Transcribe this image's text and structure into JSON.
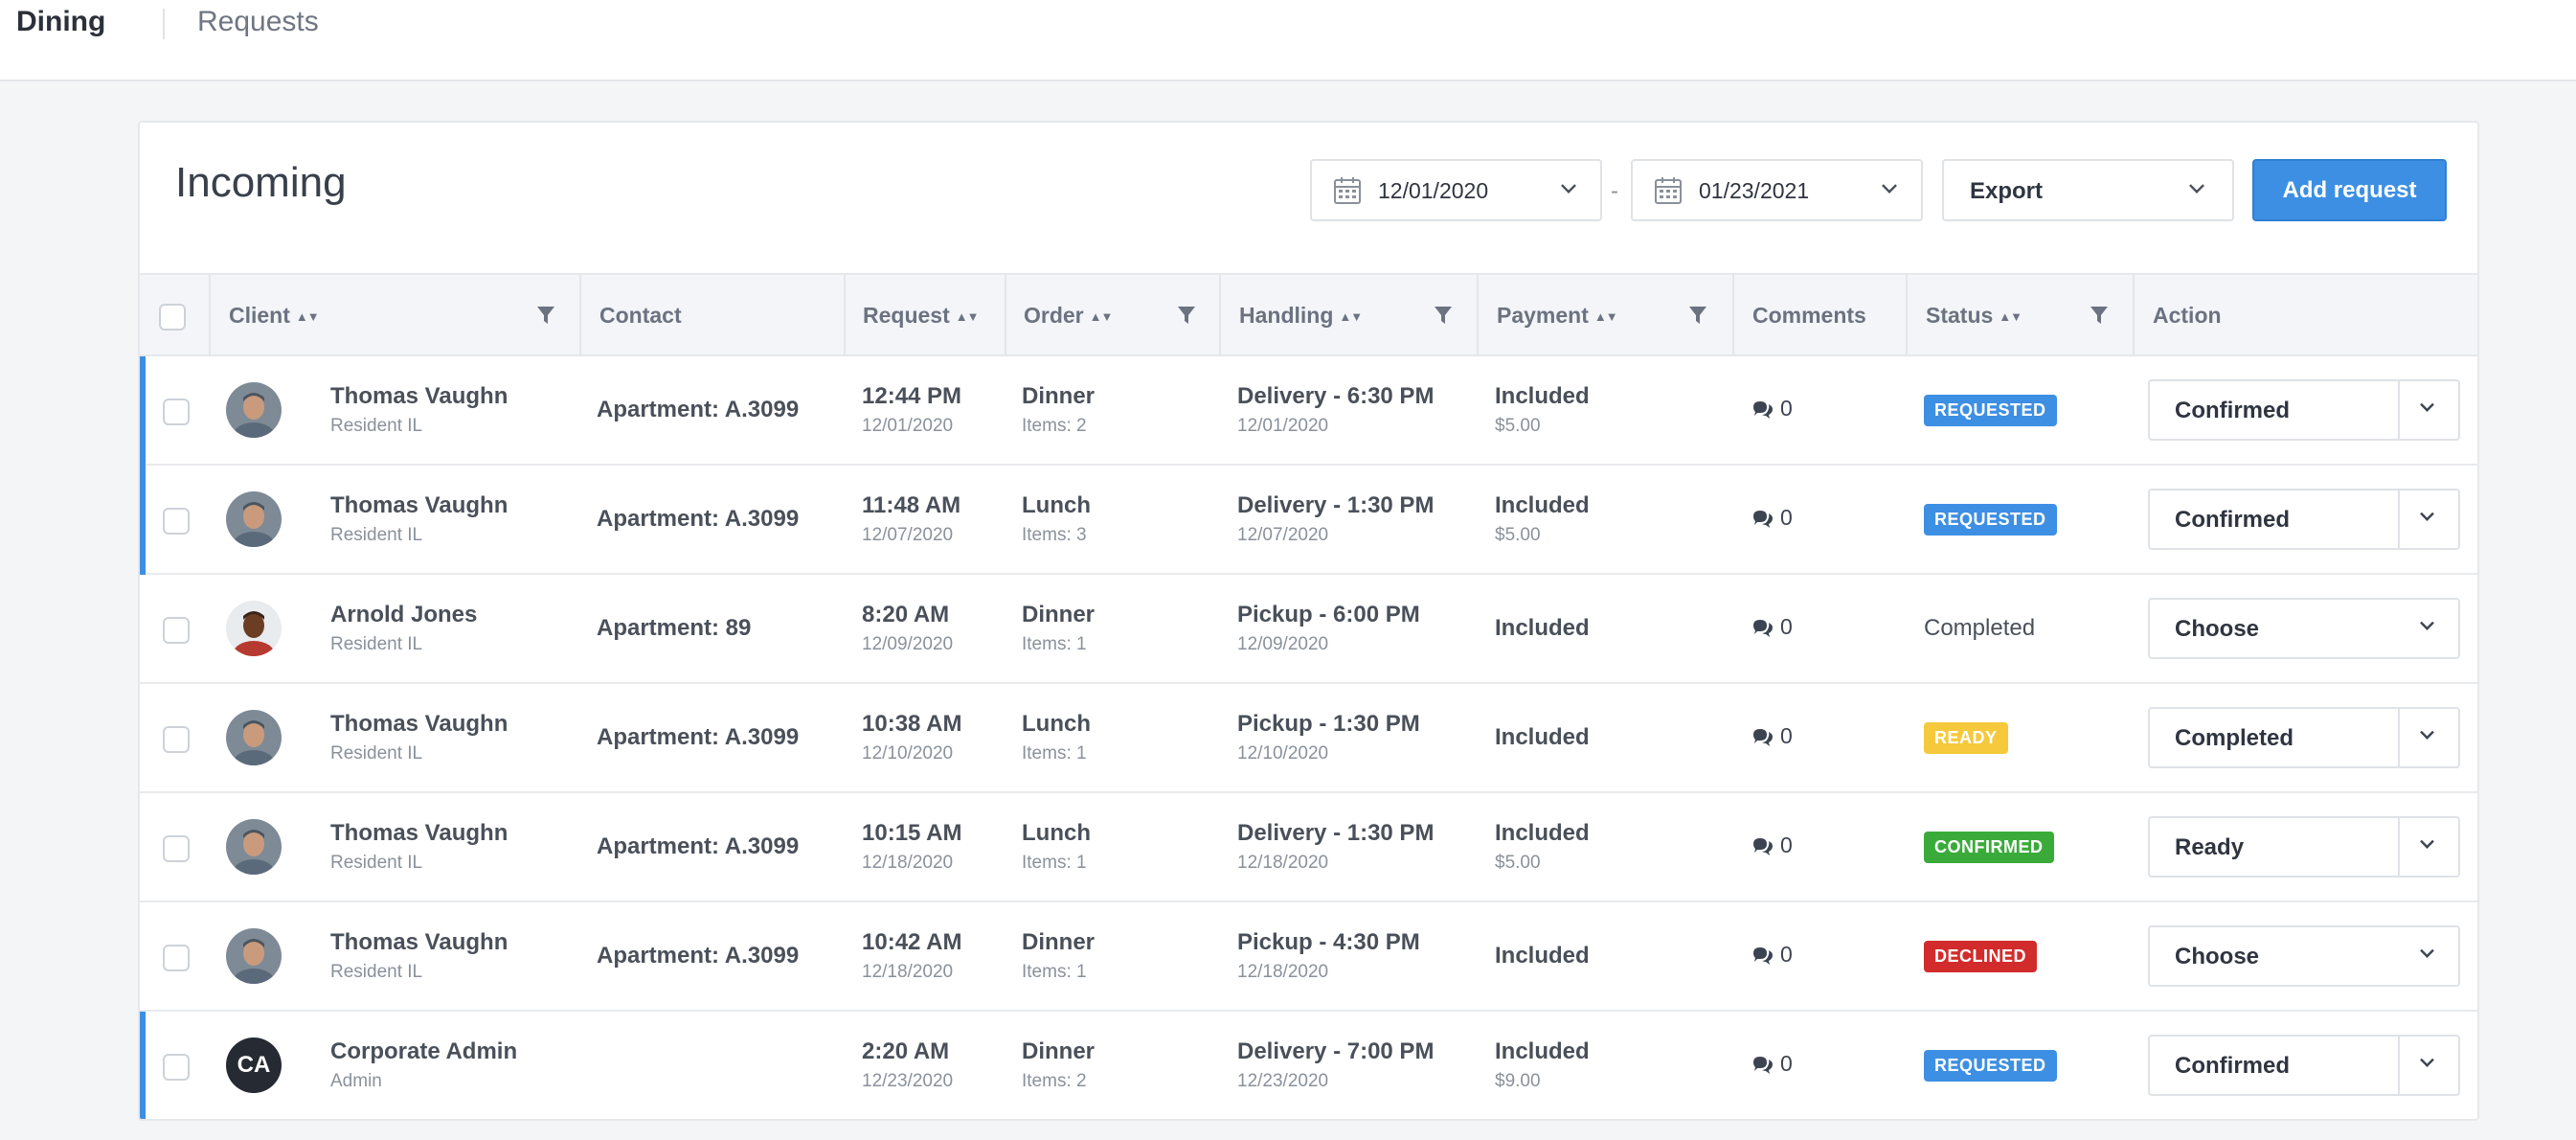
{
  "nav": {
    "tabs": [
      "Dining",
      "Requests"
    ]
  },
  "header": {
    "title": "Incoming",
    "date_from": "12/01/2020",
    "date_to": "01/23/2021",
    "date_separator": "-",
    "export_label": "Export",
    "add_label": "Add request"
  },
  "columns": {
    "client": "Client",
    "contact": "Contact",
    "request": "Request",
    "order": "Order",
    "handling": "Handling",
    "payment": "Payment",
    "comments": "Comments",
    "status": "Status",
    "action": "Action"
  },
  "colors": {
    "accent": "#3d8fe3",
    "requested": "#3d8fe3",
    "ready": "#f5c93b",
    "confirmed": "#3aab3a",
    "declined": "#d22b2b"
  },
  "rows": [
    {
      "accent": true,
      "avatar": "man-photo",
      "initials": "",
      "client_name": "Thomas Vaughn",
      "client_role": "Resident IL",
      "contact": "Apartment: A.3099",
      "request_time": "12:44 PM",
      "request_date": "12/01/2020",
      "order": "Dinner",
      "items": "Items: 2",
      "handling": "Delivery - 6:30 PM",
      "handling_date": "12/01/2020",
      "payment": "Included",
      "payment_amount": "$5.00",
      "comments": "0",
      "status": "REQUESTED",
      "status_kind": "requested",
      "action": "Confirmed",
      "split": true
    },
    {
      "accent": true,
      "avatar": "man-photo",
      "initials": "",
      "client_name": "Thomas Vaughn",
      "client_role": "Resident IL",
      "contact": "Apartment: A.3099",
      "request_time": "11:48 AM",
      "request_date": "12/07/2020",
      "order": "Lunch",
      "items": "Items: 3",
      "handling": "Delivery - 1:30 PM",
      "handling_date": "12/07/2020",
      "payment": "Included",
      "payment_amount": "$5.00",
      "comments": "0",
      "status": "REQUESTED",
      "status_kind": "requested",
      "action": "Confirmed",
      "split": true
    },
    {
      "accent": false,
      "avatar": "man-photo-2",
      "initials": "",
      "client_name": "Arnold Jones",
      "client_role": "Resident IL",
      "contact": "Apartment: 89",
      "request_time": "8:20 AM",
      "request_date": "12/09/2020",
      "order": "Dinner",
      "items": "Items: 1",
      "handling": "Pickup - 6:00 PM",
      "handling_date": "12/09/2020",
      "payment": "Included",
      "payment_amount": "",
      "comments": "0",
      "status": "Completed",
      "status_kind": "text",
      "action": "Choose",
      "split": false
    },
    {
      "accent": false,
      "avatar": "man-photo",
      "initials": "",
      "client_name": "Thomas Vaughn",
      "client_role": "Resident IL",
      "contact": "Apartment: A.3099",
      "request_time": "10:38 AM",
      "request_date": "12/10/2020",
      "order": "Lunch",
      "items": "Items: 1",
      "handling": "Pickup - 1:30 PM",
      "handling_date": "12/10/2020",
      "payment": "Included",
      "payment_amount": "",
      "comments": "0",
      "status": "READY",
      "status_kind": "ready",
      "action": "Completed",
      "split": true
    },
    {
      "accent": false,
      "avatar": "man-photo",
      "initials": "",
      "client_name": "Thomas Vaughn",
      "client_role": "Resident IL",
      "contact": "Apartment: A.3099",
      "request_time": "10:15 AM",
      "request_date": "12/18/2020",
      "order": "Lunch",
      "items": "Items: 1",
      "handling": "Delivery - 1:30 PM",
      "handling_date": "12/18/2020",
      "payment": "Included",
      "payment_amount": "$5.00",
      "comments": "0",
      "status": "CONFIRMED",
      "status_kind": "confirmed",
      "action": "Ready",
      "split": true
    },
    {
      "accent": false,
      "avatar": "man-photo",
      "initials": "",
      "client_name": "Thomas Vaughn",
      "client_role": "Resident IL",
      "contact": "Apartment: A.3099",
      "request_time": "10:42 AM",
      "request_date": "12/18/2020",
      "order": "Dinner",
      "items": "Items: 1",
      "handling": "Pickup - 4:30 PM",
      "handling_date": "12/18/2020",
      "payment": "Included",
      "payment_amount": "",
      "comments": "0",
      "status": "DECLINED",
      "status_kind": "declined",
      "action": "Choose",
      "split": false
    },
    {
      "accent": true,
      "avatar": "initials",
      "initials": "CA",
      "client_name": "Corporate Admin",
      "client_role": "Admin",
      "contact": "",
      "request_time": "2:20 AM",
      "request_date": "12/23/2020",
      "order": "Dinner",
      "items": "Items: 2",
      "handling": "Delivery - 7:00 PM",
      "handling_date": "12/23/2020",
      "payment": "Included",
      "payment_amount": "$9.00",
      "comments": "0",
      "status": "REQUESTED",
      "status_kind": "requested",
      "action": "Confirmed",
      "split": true
    }
  ]
}
